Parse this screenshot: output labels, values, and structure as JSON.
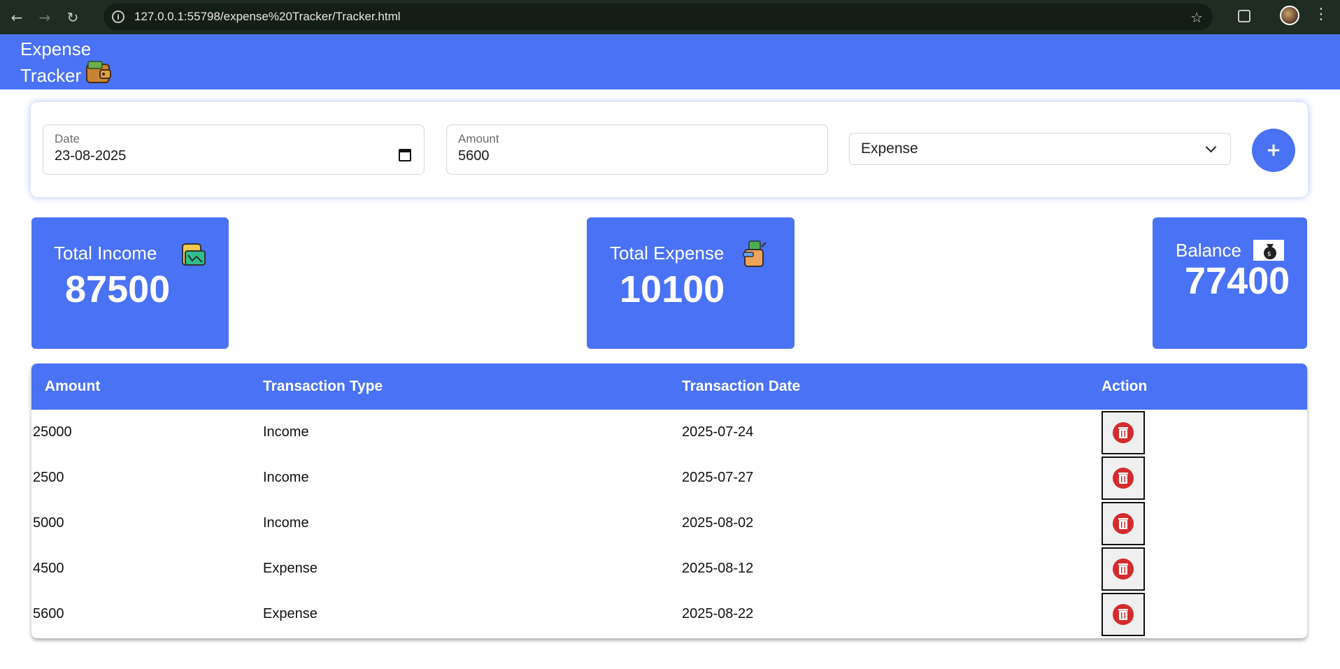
{
  "browser": {
    "url": "127.0.0.1:55798/expense%20Tracker/Tracker.html"
  },
  "header": {
    "title_line1": "Expense",
    "title_line2": "Tracker"
  },
  "form": {
    "date_label": "Date",
    "date_value": "23-08-2025",
    "amount_label": "Amount",
    "amount_value": "5600",
    "type_selected": "Expense",
    "add_label": "+"
  },
  "summary": {
    "income_title": "Total Income",
    "income_value": "87500",
    "expense_title": "Total Expense",
    "expense_value": "10100",
    "balance_title": "Balance",
    "balance_value": "77400"
  },
  "table": {
    "headers": [
      "Amount",
      "Transaction Type",
      "Transaction Date",
      "Action"
    ],
    "rows": [
      {
        "amount": "25000",
        "type": "Income",
        "date": "2025-07-24"
      },
      {
        "amount": "2500",
        "type": "Income",
        "date": "2025-07-27"
      },
      {
        "amount": "5000",
        "type": "Income",
        "date": "2025-08-02"
      },
      {
        "amount": "4500",
        "type": "Expense",
        "date": "2025-08-12"
      },
      {
        "amount": "5600",
        "type": "Expense",
        "date": "2025-08-22"
      }
    ]
  },
  "colors": {
    "accent": "#4a72f5",
    "delete": "#d42b2b"
  }
}
